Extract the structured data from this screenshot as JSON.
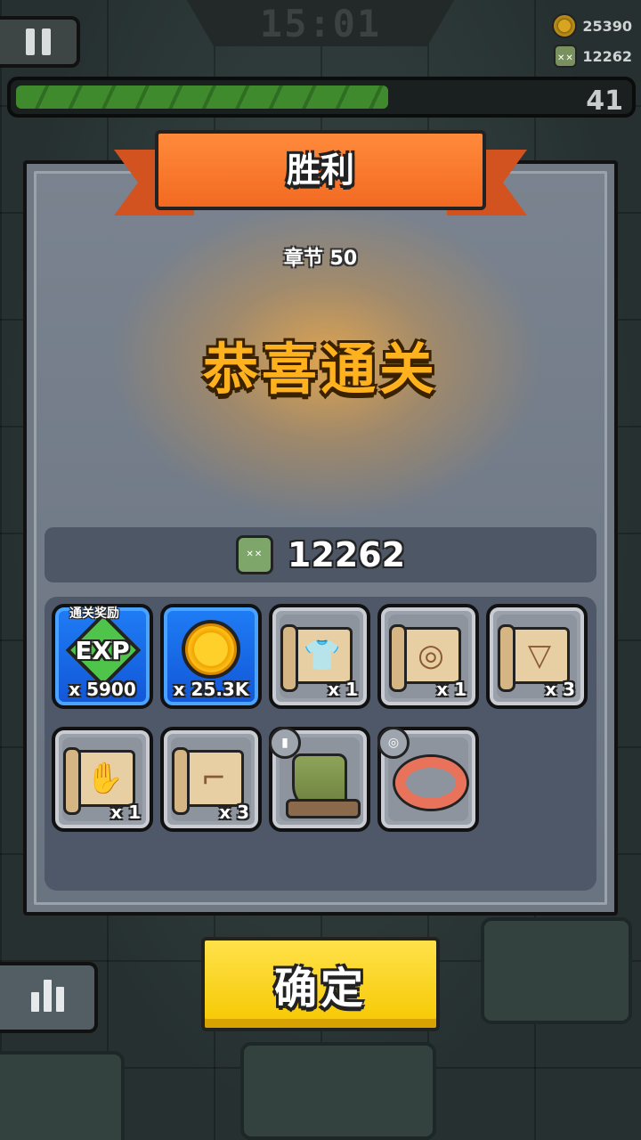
{
  "hud": {
    "timer": "15:01",
    "gold": "25390",
    "kills": "12262",
    "level": "41",
    "xp_progress": 0.61
  },
  "dialog": {
    "title": "胜利",
    "chapter": "章节 50",
    "headline": "恭喜通关",
    "kill_count": "12262"
  },
  "rewards": {
    "clear_reward_tag": "通关奖励",
    "exp_label": "EXP",
    "items": [
      {
        "name": "exp",
        "qty": "x 5900"
      },
      {
        "name": "gold-coin",
        "qty": "x 25.3K"
      },
      {
        "name": "armor-blueprint",
        "qty": "x 1"
      },
      {
        "name": "belt-blueprint",
        "qty": "x 1"
      },
      {
        "name": "necklace-blueprint",
        "qty": "x 3"
      },
      {
        "name": "glove-blueprint",
        "qty": "x 1"
      },
      {
        "name": "pistol-blueprint",
        "qty": "x 3"
      },
      {
        "name": "boots",
        "qty": ""
      },
      {
        "name": "collar",
        "qty": ""
      }
    ]
  },
  "buttons": {
    "confirm": "确定"
  }
}
